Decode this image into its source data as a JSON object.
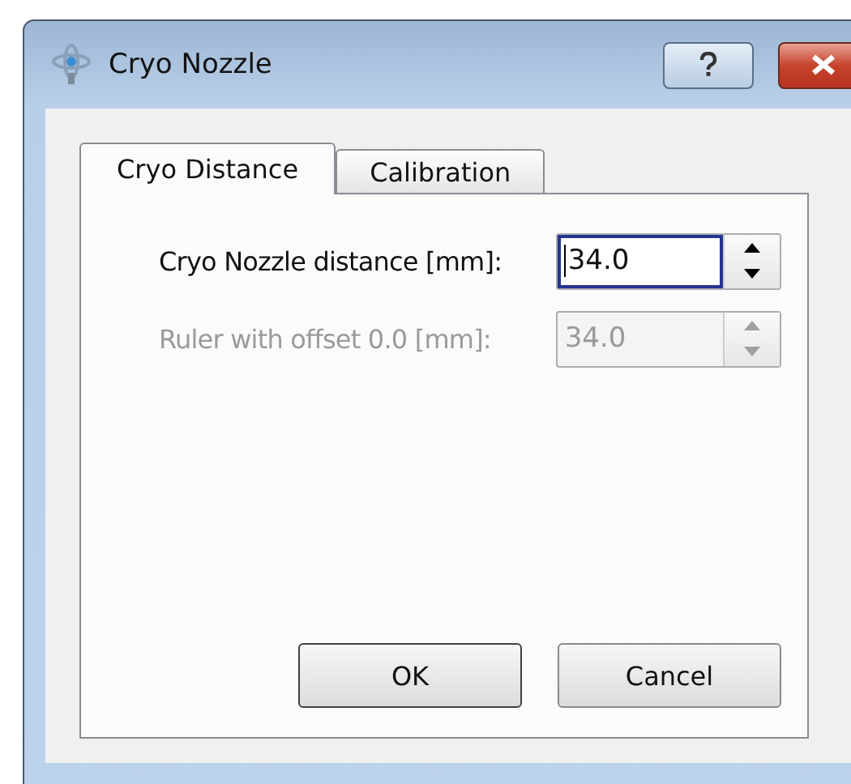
{
  "window": {
    "title": "Cryo Nozzle"
  },
  "tabs": [
    {
      "label": "Cryo Distance",
      "selected": true
    },
    {
      "label": "Calibration",
      "selected": false
    }
  ],
  "fields": [
    {
      "label": "Cryo Nozzle distance [mm]:",
      "value": "34.0",
      "disabled": false,
      "focused": true
    },
    {
      "label": "Ruler with offset 0.0 [mm]:",
      "value": "34.0",
      "disabled": true,
      "focused": false
    }
  ],
  "buttons": [
    {
      "label": "OK",
      "default": true
    },
    {
      "label": "Cancel",
      "default": false
    }
  ]
}
